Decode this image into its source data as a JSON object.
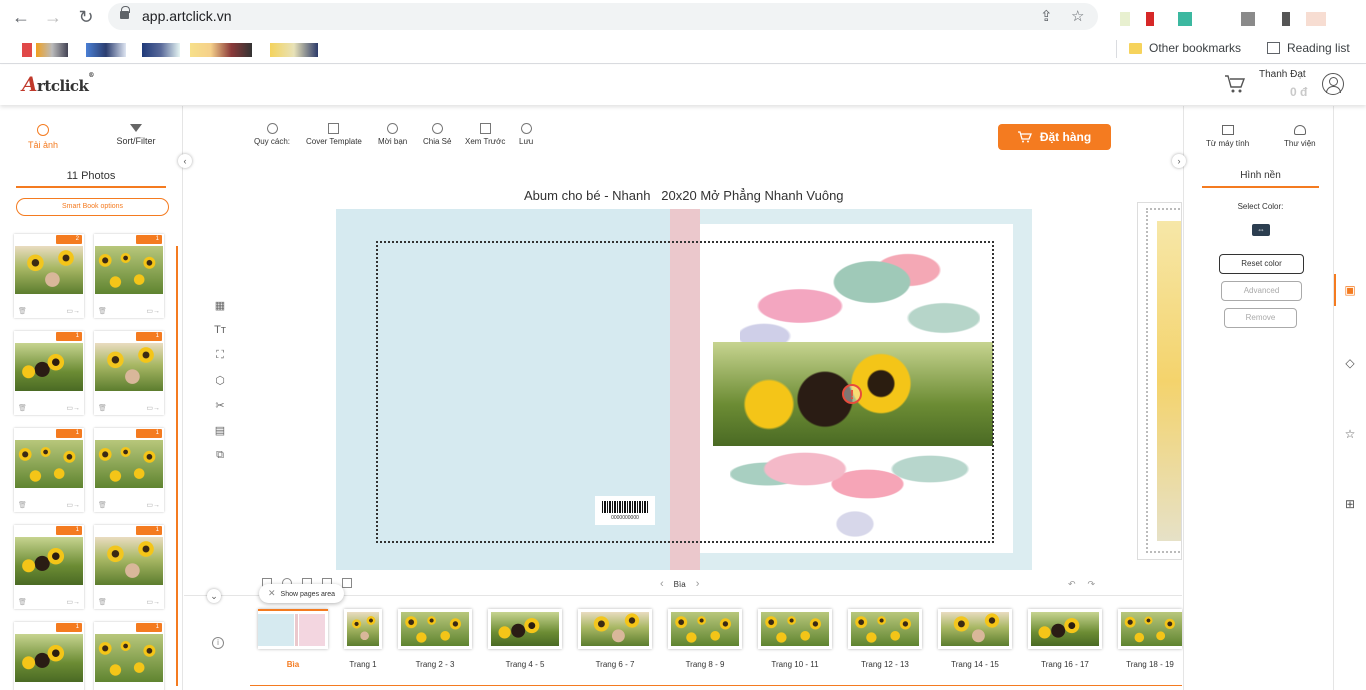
{
  "browser": {
    "url": "app.artclick.vn",
    "bookmarks": {
      "other_bookmarks": "Other bookmarks",
      "reading_list": "Reading list"
    }
  },
  "header": {
    "logo_text": "rtclick",
    "logo_initial": "A",
    "user_name": "Thanh Đạt",
    "balance": "0 đ"
  },
  "left_panel": {
    "tabs": [
      {
        "label": "Tải ảnh",
        "icon": "info-icon",
        "active": true
      },
      {
        "label": "Sort/Filter",
        "icon": "filter-icon",
        "active": false
      }
    ],
    "photos_count": "11 Photos",
    "smart_book_button": "Smart Book options",
    "thumbnails": [
      {
        "badge": "2"
      },
      {
        "badge": "1"
      },
      {
        "badge": "1"
      },
      {
        "badge": "1"
      },
      {
        "badge": "1"
      },
      {
        "badge": "1"
      },
      {
        "badge": "1"
      },
      {
        "badge": "1"
      },
      {
        "badge": "1"
      },
      {
        "badge": "1"
      }
    ]
  },
  "toolbar": {
    "tools": [
      {
        "label": "Quy cách:",
        "icon": "info-icon"
      },
      {
        "label": "Cover Template",
        "icon": "template-icon"
      },
      {
        "label": "Mời bạn",
        "icon": "invite-icon"
      },
      {
        "label": "Chia Sẻ",
        "icon": "share-icon"
      },
      {
        "label": "Xem Trước",
        "icon": "preview-icon"
      },
      {
        "label": "Lưu",
        "icon": "cloud-upload-icon"
      }
    ],
    "order_button": "Đặt hàng"
  },
  "editor": {
    "book_title": "Abum cho bé - Nhanh   20x20 Mở Phẳng Nhanh Vuông",
    "warning_symbol": "!",
    "barcode_number": "0000000000",
    "page_nav_label": "Bìa",
    "show_pages_area": "Show pages area"
  },
  "pages": [
    {
      "label": "Bìa",
      "active": true
    },
    {
      "label": "Trang 1",
      "active": false
    },
    {
      "label": "Trang 2 - 3",
      "active": false
    },
    {
      "label": "Trang 4 - 5",
      "active": false
    },
    {
      "label": "Trang 6 - 7",
      "active": false
    },
    {
      "label": "Trang 8 - 9",
      "active": false
    },
    {
      "label": "Trang 10 - 11",
      "active": false
    },
    {
      "label": "Trang 12 - 13",
      "active": false
    },
    {
      "label": "Trang 14 - 15",
      "active": false
    },
    {
      "label": "Trang 16 - 17",
      "active": false
    },
    {
      "label": "Trang 18 - 19",
      "active": false
    }
  ],
  "right_panel": {
    "tabs": [
      {
        "label": "Từ máy tính",
        "icon": "computer-icon"
      },
      {
        "label": "Thư viện",
        "icon": "cloud-icon"
      }
    ],
    "title": "Hình nền",
    "select_color": "Select Color:",
    "buttons": {
      "reset_color": "Reset color",
      "advanced": "Advanced",
      "remove": "Remove"
    }
  },
  "colors": {
    "accent": "#f47b20",
    "cover_background": "#d6eaf0",
    "spine": "#ebc8cc"
  }
}
